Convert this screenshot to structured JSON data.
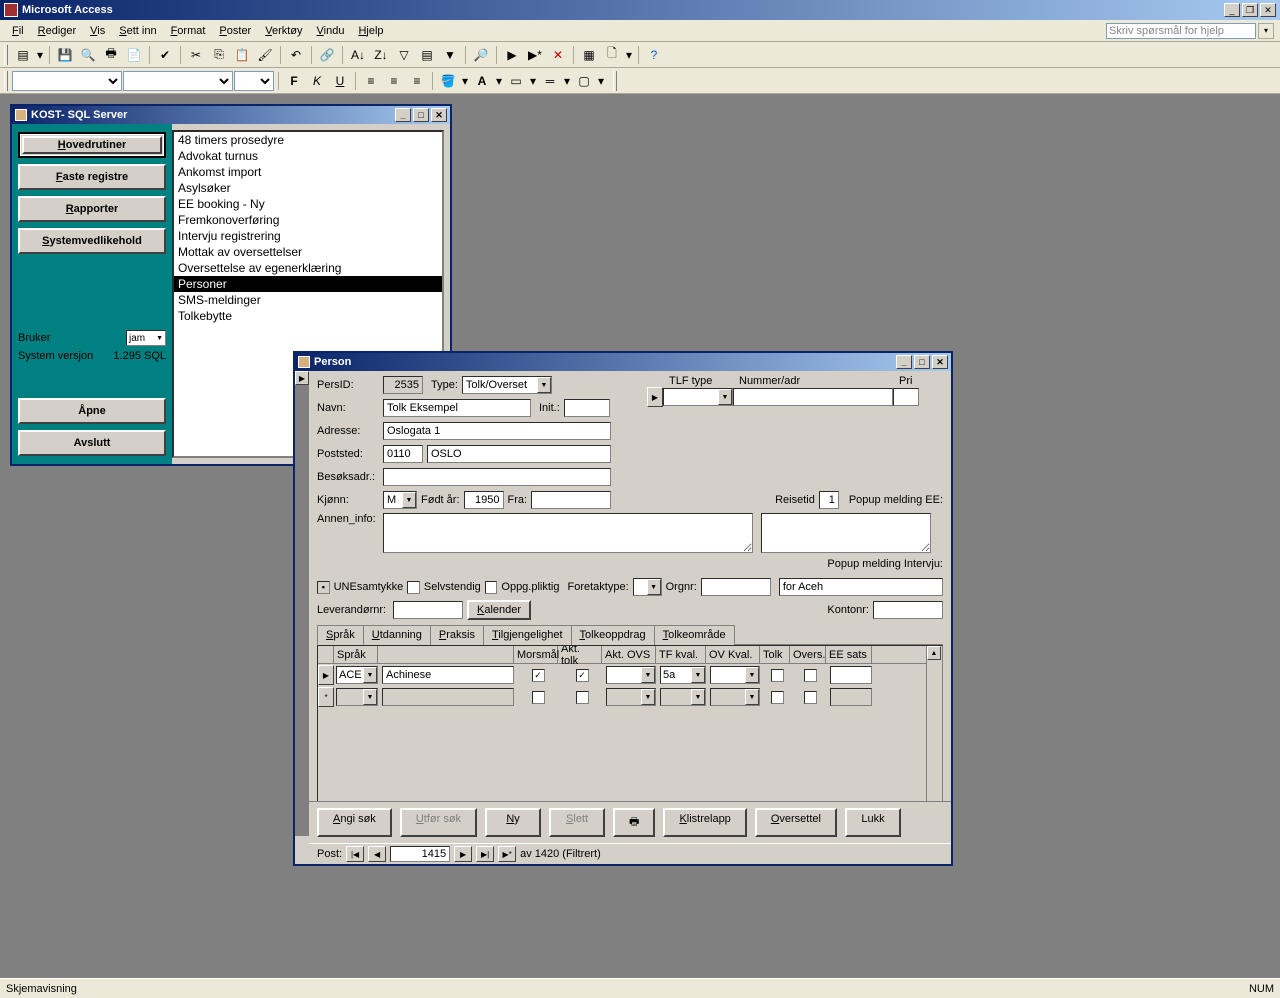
{
  "app": {
    "title": "Microsoft Access"
  },
  "menus": [
    "Fil",
    "Rediger",
    "Vis",
    "Sett inn",
    "Format",
    "Poster",
    "Verktøy",
    "Vindu",
    "Hjelp"
  ],
  "help_placeholder": "Skriv spørsmål for hjelp",
  "statusbar": {
    "left": "Skjemavisning",
    "num": "NUM"
  },
  "kost": {
    "title": "KOST- SQL Server",
    "buttons": [
      "Hovedrutiner",
      "Faste registre",
      "Rapporter",
      "Systemvedlikehold"
    ],
    "bruker_label": "Bruker",
    "bruker_value": "jam",
    "versjon_label": "System versjon",
    "versjon_value": "1.295 SQL",
    "apne": "Åpne",
    "avslutt": "Avslutt",
    "list": [
      "48 timers prosedyre",
      "Advokat turnus",
      "Ankomst import",
      "Asylsøker",
      "EE booking - Ny",
      "Fremkonoverføring",
      "Intervju registrering",
      "Mottak av oversettelser",
      "Oversettelse av egenerklæring",
      "Personer",
      "SMS-meldinger",
      "Tolkebytte"
    ],
    "selected": "Personer"
  },
  "person": {
    "title": "Person",
    "labels": {
      "persid": "PersID:",
      "type": "Type:",
      "navn": "Navn:",
      "init": "Init.:",
      "adresse": "Adresse:",
      "poststed": "Poststed:",
      "besok": "Besøksadr.:",
      "kjonn": "Kjønn:",
      "fodtar": "Født år:",
      "fra": "Fra:",
      "reisetid": "Reisetid",
      "popup_ee": "Popup melding EE:",
      "annen": "Annen_info:",
      "popup_int": "Popup melding Intervju:",
      "une": "UNEsamtykke",
      "selvstendig": "Selvstendig",
      "oppg": "Oppg.pliktig",
      "foretaktype": "Foretaktype:",
      "orgnr": "Orgnr:",
      "leverandor": "Leverandørnr:",
      "kalender": "Kalender",
      "kontonr": "Kontonr:"
    },
    "values": {
      "persid": "2535",
      "type": "Tolk/Overset",
      "navn": "Tolk Eksempel",
      "init": "",
      "adresse": "Oslogata 1",
      "postnr": "0110",
      "poststed": "OSLO",
      "besok": "",
      "kjonn": "M",
      "fodtar": "1950",
      "fra": "",
      "reisetid": "1",
      "annen": "",
      "popup_int_val": "for Aceh",
      "orgnr": "",
      "leverandor": "",
      "kontonr": ""
    },
    "tlf": {
      "headers": [
        "TLF type",
        "Nummer/adr",
        "Pri"
      ]
    },
    "tabs": [
      "Språk",
      "Utdanning",
      "Praksis",
      "Tilgjengelighet",
      "Tolkeoppdrag",
      "Tolkeområde"
    ],
    "active_tab": "Språk",
    "sprak": {
      "headers": [
        "Språk",
        "",
        "Morsmål",
        "Akt. tolk",
        "Akt. OVS",
        "TF kval.",
        "OV Kval.",
        "Tolk",
        "Overs.",
        "EE sats"
      ],
      "row": {
        "code": "ACE",
        "name": "Achinese",
        "morsmal": true,
        "akttolk": true,
        "aktovs": "",
        "tfkval": "5a",
        "ovkval": "",
        "tolk": false,
        "overs": false,
        "eesats": ""
      }
    },
    "buttons": {
      "angi": "Angi søk",
      "utfor": "Utfør søk",
      "ny": "Ny",
      "slett": "Slett",
      "klistrelapp": "Klistrelapp",
      "oversettel": "Oversettel",
      "lukk": "Lukk"
    },
    "nav": {
      "label": "Post:",
      "current": "1415",
      "total": "av  1420 (Filtrert)"
    }
  }
}
